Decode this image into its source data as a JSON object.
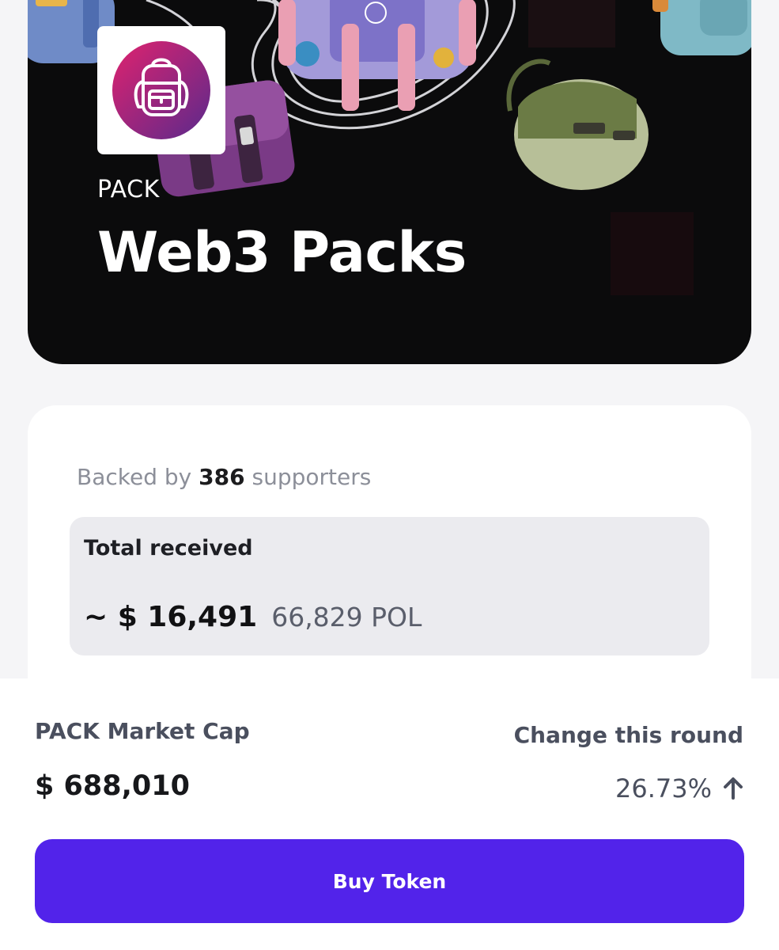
{
  "hero": {
    "ticker": "PACK",
    "title": "Web3 Packs",
    "logo_icon": "backpack-icon",
    "banner_colors": {
      "background": "#0b0b0c",
      "logo_gradient_start": "#e0226e",
      "logo_gradient_end": "#5a2a8c"
    }
  },
  "stats": {
    "backed_prefix": "Backed by",
    "supporters_count": "386",
    "backed_suffix": "supporters",
    "total_received_label": "Total received",
    "total_received_usd": "~ $ 16,491",
    "total_received_pol": "66,829 POL"
  },
  "market": {
    "market_cap_label": "PACK Market Cap",
    "market_cap_value": "$ 688,010",
    "change_label": "Change this round",
    "change_value": "26.73%",
    "change_icon": "arrow-up-icon"
  },
  "actions": {
    "buy_label": "Buy Token",
    "accent_color": "#5223ea"
  }
}
